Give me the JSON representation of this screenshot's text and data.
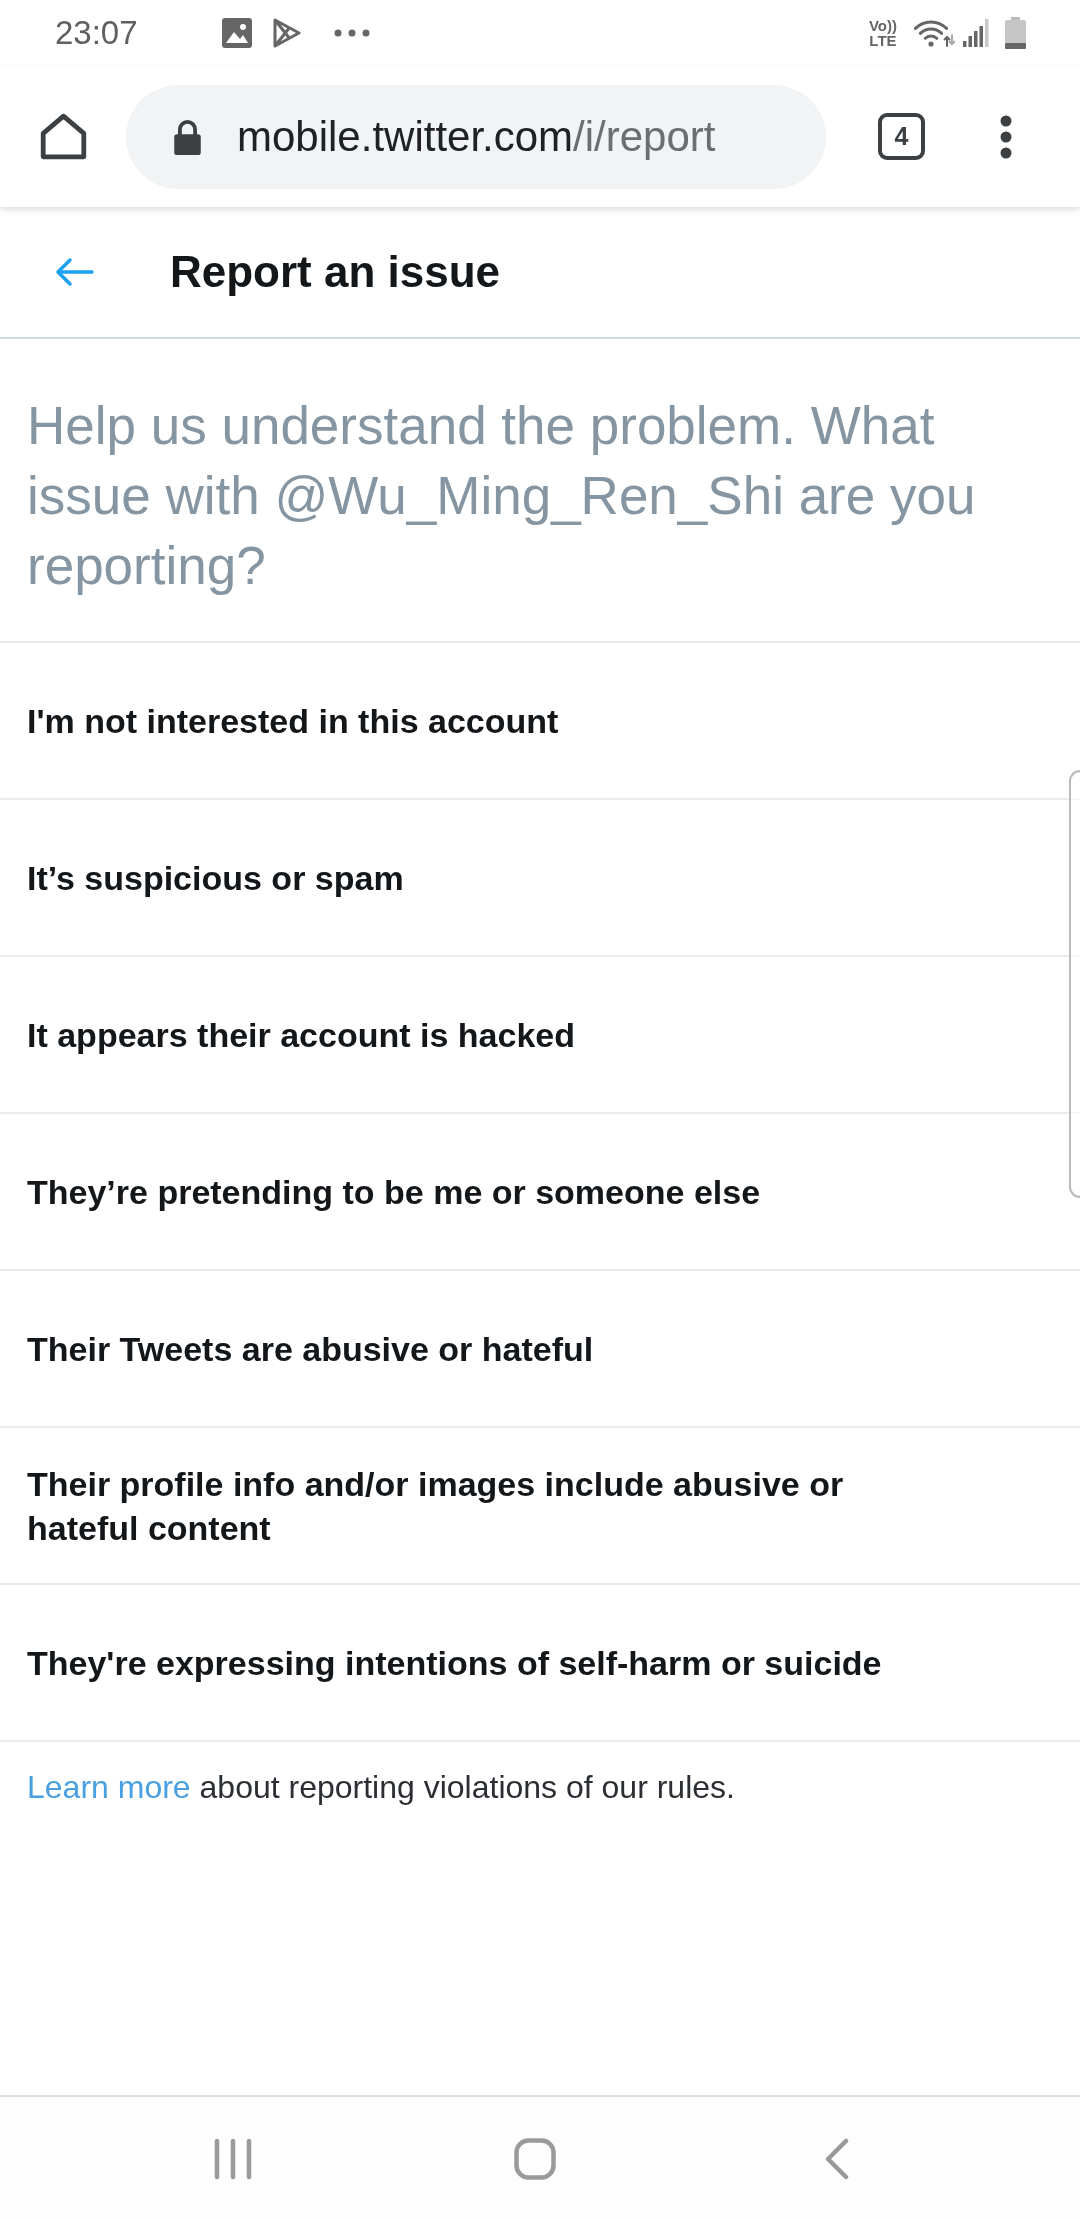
{
  "status_bar": {
    "time": "23:07",
    "network_type": {
      "top": "Vo))",
      "bottom": "LTE"
    }
  },
  "browser_toolbar": {
    "address_bar": {
      "host": "mobile.twitter.com",
      "path": "/i/report"
    },
    "tab_count": "4"
  },
  "header": {
    "title": "Report an issue"
  },
  "prompt": "Help us understand the problem. What issue with @Wu_Ming_Ren_Shi are you reporting?",
  "options": [
    {
      "label": "I'm not interested in this account"
    },
    {
      "label": "It’s suspicious or spam"
    },
    {
      "label": "It appears their account is hacked"
    },
    {
      "label": "They’re pretending to be me or someone else"
    },
    {
      "label": "Their Tweets are abusive or hateful"
    },
    {
      "label": "Their profile info and/or images include abusive or hateful content"
    },
    {
      "label": "They're expressing intentions of self-harm or suicide"
    }
  ],
  "footer": {
    "link": "Learn more",
    "text": "about reporting violations of our rules."
  }
}
